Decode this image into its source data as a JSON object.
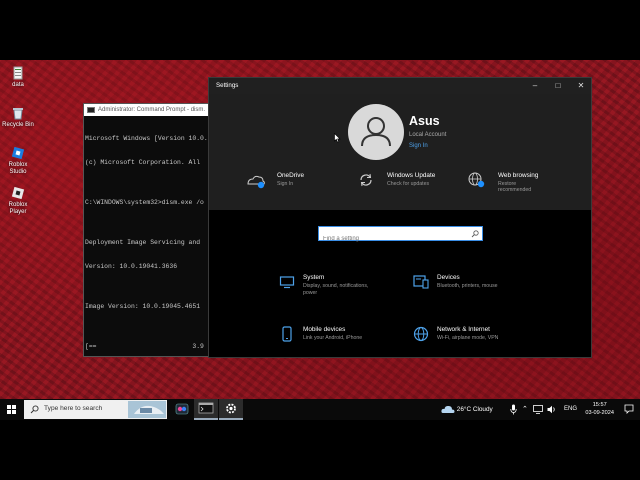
{
  "desktop": {
    "icons": [
      {
        "label": "data",
        "icon": "text-file-icon"
      },
      {
        "label": "Recycle Bin",
        "icon": "recycle-bin-icon"
      },
      {
        "label": "Roblox Studio",
        "icon": "roblox-studio-icon"
      },
      {
        "label": "Roblox Player",
        "icon": "roblox-player-icon"
      }
    ]
  },
  "cmd": {
    "title": "Administrator: Command Prompt - dism.",
    "lines": [
      "Microsoft Windows [Version 10.0.",
      "(c) Microsoft Corporation. All",
      "",
      "C:\\WINDOWS\\system32>dism.exe /o",
      "",
      "Deployment Image Servicing and",
      "Version: 10.0.19041.3636",
      "",
      "Image Version: 10.0.19045.4651",
      "",
      "[==                         3.9"
    ]
  },
  "settings": {
    "title": "Settings",
    "user": {
      "name": "Asus",
      "account_type": "Local Account",
      "sign_in": "Sign In"
    },
    "quick": [
      {
        "title": "OneDrive",
        "sub": "Sign In",
        "icon": "onedrive-icon"
      },
      {
        "title": "Windows Update",
        "sub": "Check for updates",
        "icon": "windows-update-icon"
      },
      {
        "title": "Web browsing",
        "sub": "Restore\nrecommended",
        "icon": "web-browsing-icon"
      }
    ],
    "search": {
      "placeholder": "Find a setting"
    },
    "categories": [
      {
        "title": "System",
        "sub": "Display, sound, notifications,\npower",
        "icon": "system-icon"
      },
      {
        "title": "Devices",
        "sub": "Bluetooth, printers, mouse",
        "icon": "devices-icon"
      },
      {
        "title": "Mobile devices",
        "sub": "Link your Android, iPhone",
        "icon": "phone-icon"
      },
      {
        "title": "Network & Internet",
        "sub": "Wi-Fi, airplane mode, VPN",
        "icon": "globe-icon"
      }
    ]
  },
  "taskbar": {
    "search_text": "Type here to search",
    "weather": "26°C  Cloudy",
    "language": "ENG",
    "time": "15:57",
    "date": "03-09-2024"
  },
  "colors": {
    "accent": "#4ea2ea",
    "wallpaper": "#8c1520"
  }
}
